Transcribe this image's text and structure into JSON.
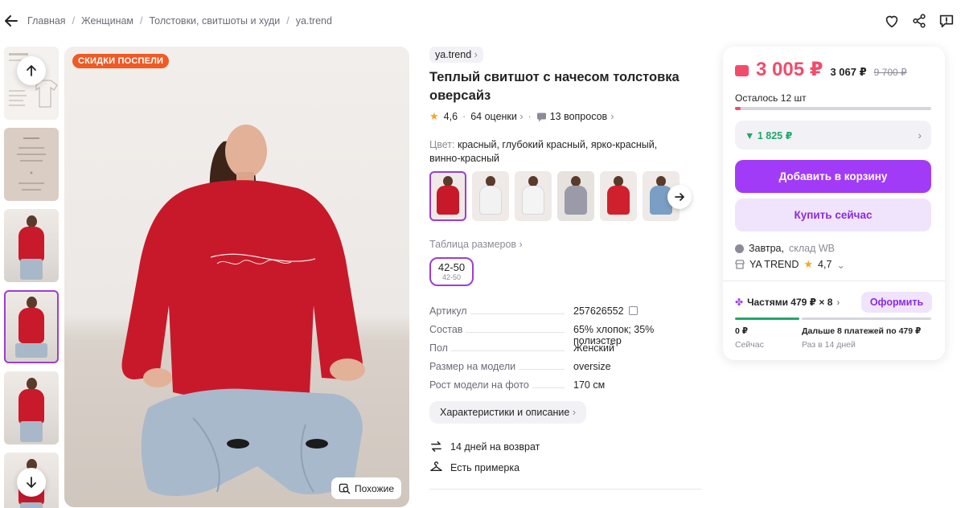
{
  "breadcrumbs": [
    "Главная",
    "Женщинам",
    "Толстовки, свитшоты и худи",
    "ya.trend"
  ],
  "promo_badge": "СКИДКИ ПОСПЕЛИ",
  "similar_label": "Похожие",
  "brand": "ya.trend",
  "title": "Теплый свитшот с начесом толстовка оверсайз",
  "rating": "4,6",
  "reviews": "64 оценки",
  "questions": "13 вопросов",
  "color_label": "Цвет:",
  "color_value": "красный, глубокий красный, ярко-красный, винно-красный",
  "swatch_colors": [
    "#c8192a",
    "#f2f2f2",
    "#f4f4f4",
    "#9a9aa8",
    "#d0202e",
    "#7a9ec4"
  ],
  "size_table_label": "Таблица размеров",
  "size": {
    "main": "42-50",
    "sub": "42-50"
  },
  "specs": [
    {
      "key": "Артикул",
      "value": "257626552"
    },
    {
      "key": "Состав",
      "value": "65% хлопок; 35% полиэстер"
    },
    {
      "key": "Пол",
      "value": "Женский"
    },
    {
      "key": "Размер на модели",
      "value": "oversize"
    },
    {
      "key": "Рост модели на фото",
      "value": "170 см"
    }
  ],
  "description_button": "Характеристики и описание",
  "features": [
    "14 дней на возврат",
    "Есть примерка"
  ],
  "price": {
    "main": "3 005 ₽",
    "secondary": "3 067 ₽",
    "old": "9 700 ₽",
    "stock_left": "Осталось 12 шт",
    "stock_fraction": 0.03,
    "promo": "▼ 1 825 ₽",
    "add_to_cart": "Добавить в корзину",
    "buy_now": "Купить сейчас",
    "delivery": "Завтра,",
    "warehouse": "склад WB",
    "seller": "YA TREND",
    "seller_rating": "4,7",
    "installment": "Частями 479 ₽ × 8",
    "installment_button": "Оформить",
    "now_amount": "0 ₽",
    "now_label": "Сейчас",
    "next_payments": "Дальше 8 платежей по 479 ₽",
    "next_interval": "Раз в 14 дней"
  },
  "colors": {
    "accent": "#a13bf7",
    "price": "#f24c6a",
    "promo": "#f15a24",
    "green": "#1fa86a"
  }
}
